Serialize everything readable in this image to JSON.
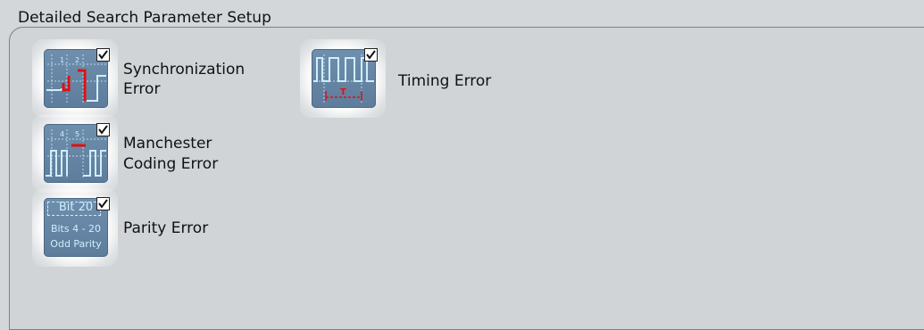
{
  "panel": {
    "title": "Detailed Search Parameter Setup"
  },
  "options": [
    {
      "id": "sync",
      "label_line1": "Synchronization",
      "label_line2": "Error",
      "icon": "synchronization-error-icon",
      "checked": true
    },
    {
      "id": "manchester",
      "label_line1": "Manchester",
      "label_line2": "Coding Error",
      "icon": "manchester-coding-error-icon",
      "checked": true,
      "tick_labels": [
        "4",
        "5"
      ]
    },
    {
      "id": "parity",
      "label_line1": "Parity Error",
      "icon": "parity-error-icon",
      "checked": true,
      "icon_text": {
        "top": "Bit 20",
        "mid": "Bits 4 - 20",
        "bottom": "Odd Parity"
      }
    },
    {
      "id": "timing",
      "label_line1": "Timing Error",
      "icon": "timing-error-icon",
      "checked": true,
      "icon_text": {
        "marker": "T"
      }
    }
  ],
  "sync_tick_labels": [
    "1",
    "2"
  ],
  "colors": {
    "tile": "#6587a8",
    "signal": "#bff0ff",
    "error": "#e01010",
    "background": "#d3d7da"
  }
}
